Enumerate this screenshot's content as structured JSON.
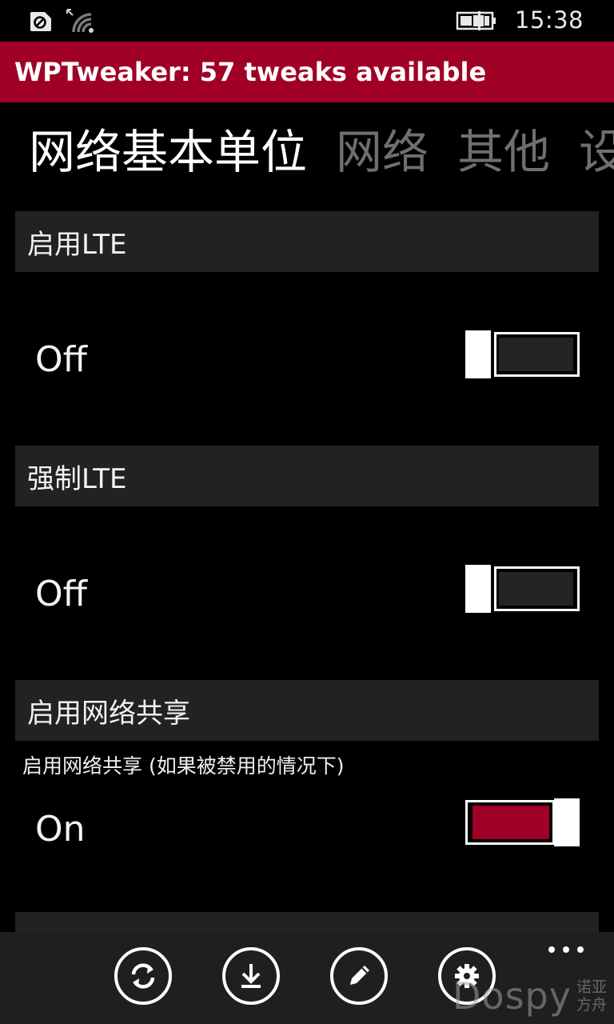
{
  "status_bar": {
    "time": "15:38",
    "icons": [
      "sim-icon",
      "wifi-signal-icon",
      "battery-charging-icon"
    ]
  },
  "banner": {
    "text": "WPTweaker: 57 tweaks available"
  },
  "pivot": {
    "items": [
      {
        "label": "网络基本单位",
        "active": true
      },
      {
        "label": "网络",
        "active": false
      },
      {
        "label": "其他",
        "active": false
      },
      {
        "label": "设",
        "active": false
      }
    ]
  },
  "settings": [
    {
      "title": "启用LTE",
      "description": "",
      "state_label": "Off",
      "on": false
    },
    {
      "title": "强制LTE",
      "description": "",
      "state_label": "Off",
      "on": false
    },
    {
      "title": "启用网络共享",
      "description": "启用网络共享 (如果被禁用的情况下)",
      "state_label": "On",
      "on": true
    }
  ],
  "app_bar": {
    "buttons": [
      {
        "icon": "refresh-icon"
      },
      {
        "icon": "download-icon"
      },
      {
        "icon": "edit-icon"
      },
      {
        "icon": "settings-gear-icon"
      }
    ],
    "more": "more-dots-icon"
  },
  "watermark": {
    "main": "Dospy",
    "side_top": "诺亚",
    "side_bottom": "方舟"
  },
  "colors": {
    "accent": "#a10026",
    "background": "#000000",
    "section_header": "#222222",
    "inactive_pivot": "#6f6f6f",
    "app_bar": "#1f1f1f"
  }
}
